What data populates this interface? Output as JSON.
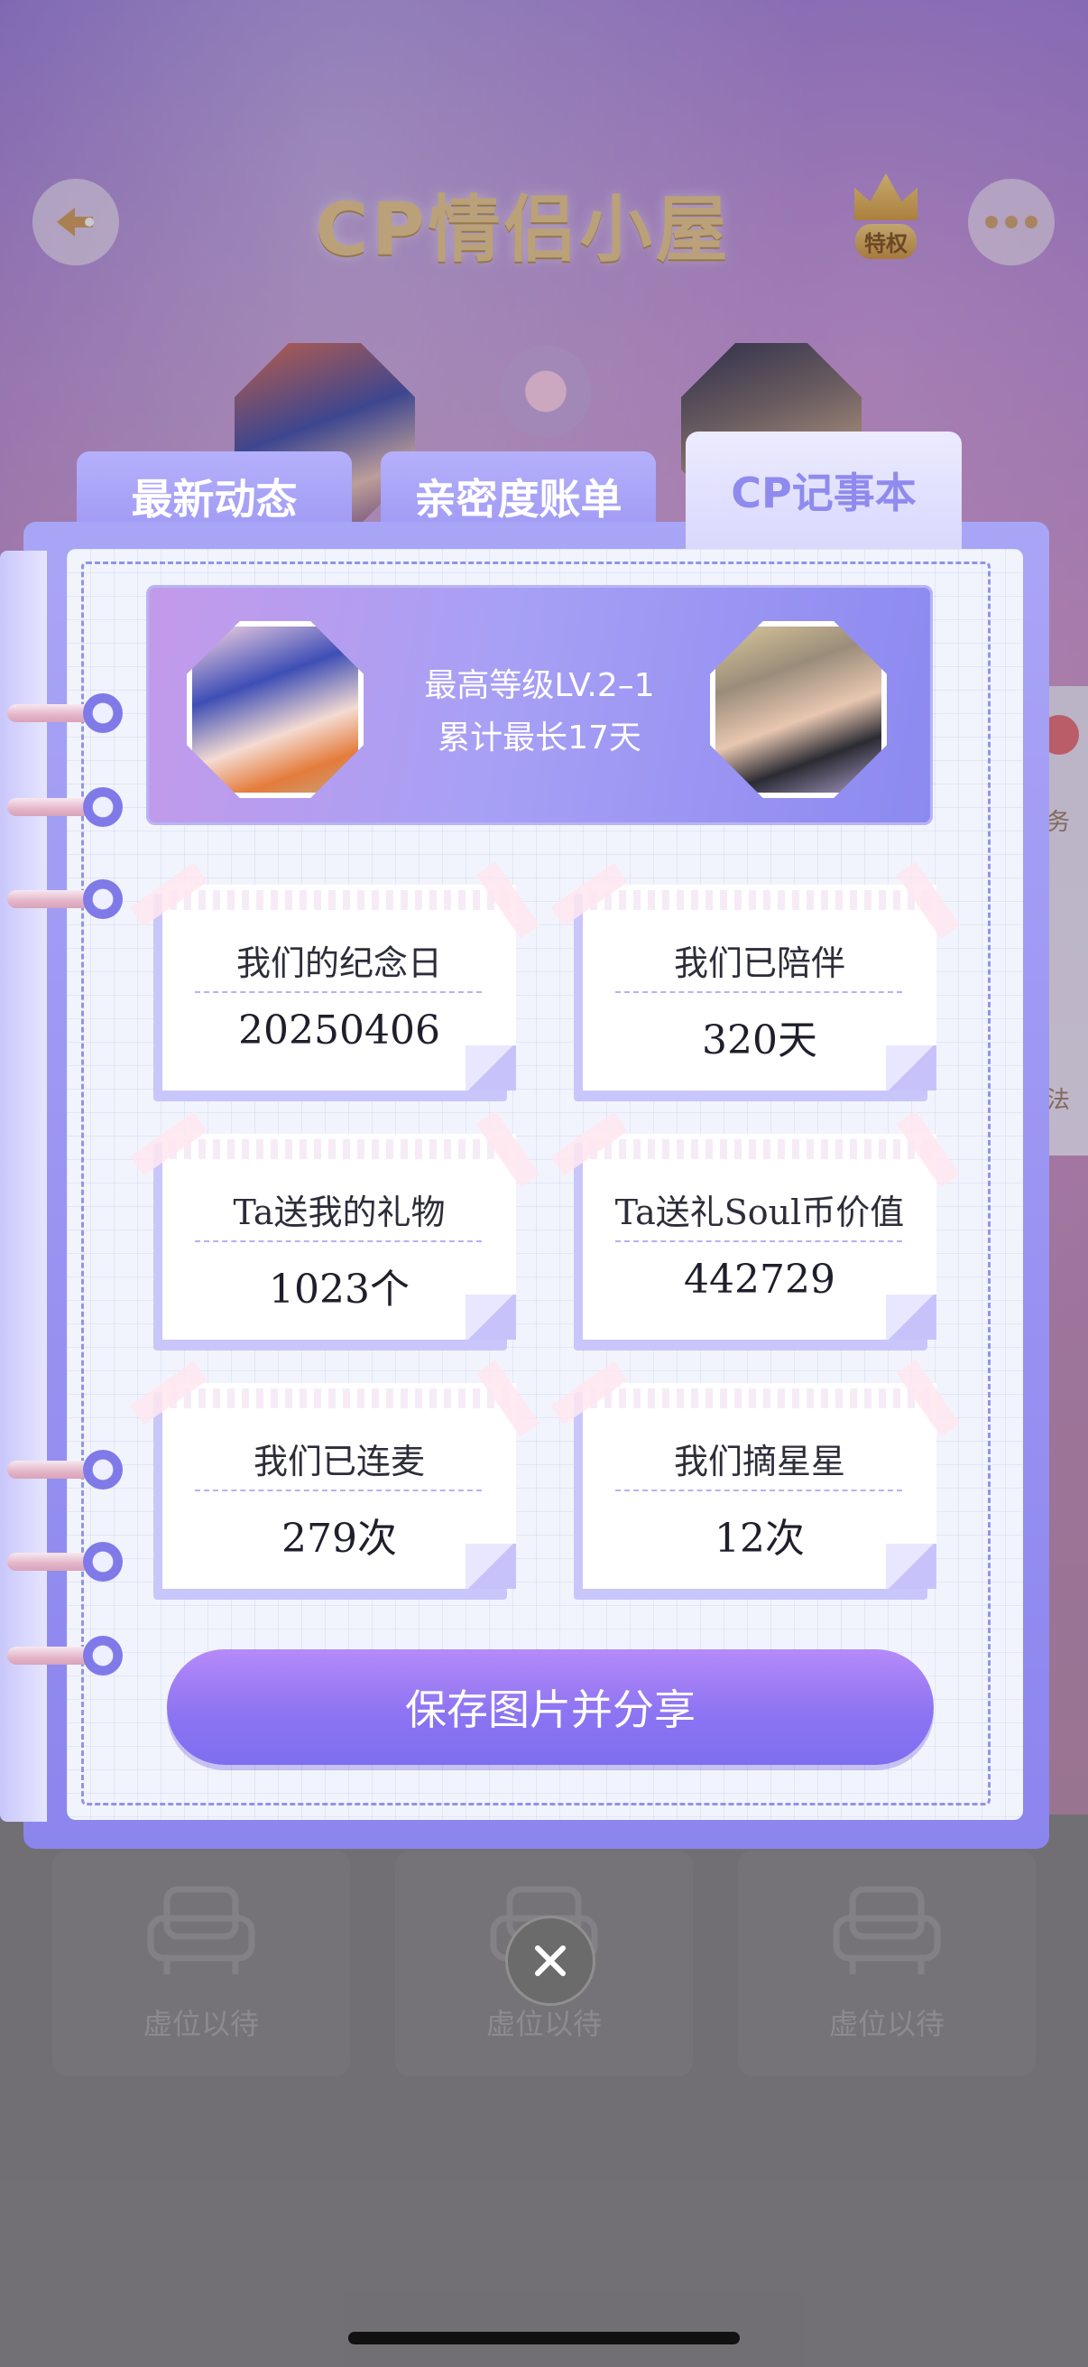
{
  "header": {
    "title": "CP情侣小屋",
    "privilege_label": "特权"
  },
  "tabs": [
    {
      "label": "最新动态"
    },
    {
      "label": "亲密度账单"
    },
    {
      "label": "CP记事本"
    }
  ],
  "hero": {
    "line1": "最高等级LV.2–1",
    "line2": "累计最长17天"
  },
  "stats": [
    {
      "title": "我们的纪念日",
      "value": "20250406"
    },
    {
      "title": "我们已陪伴",
      "value": "320天"
    },
    {
      "title": "Ta送我的礼物",
      "value": "1023个"
    },
    {
      "title": "Ta送礼Soul币价值",
      "value": "442729"
    },
    {
      "title": "我们已连麦",
      "value": "279次"
    },
    {
      "title": "我们摘星星",
      "value": "12次"
    }
  ],
  "save_button": "保存图片并分享",
  "seats": [
    {
      "label": "虚位以待"
    },
    {
      "label": "虚位以待"
    },
    {
      "label": "虚位以待"
    }
  ],
  "side_peek": {
    "text1": "务",
    "text2": "法"
  },
  "colors": {
    "accent": "#8d74f2",
    "tab_active_text": "#8f8aee",
    "privilege_gold": "#cc9136"
  },
  "icons": [
    "back-icon",
    "more-icon",
    "crown-icon",
    "sofa-icon",
    "close-icon"
  ]
}
